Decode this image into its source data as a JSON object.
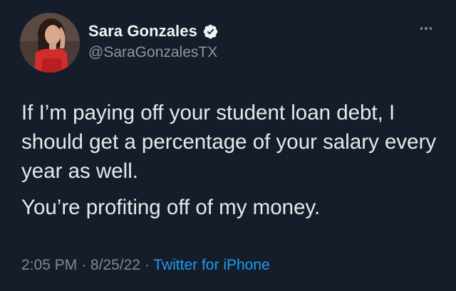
{
  "user": {
    "display_name": "Sara Gonzales",
    "handle": "@SaraGonzalesTX",
    "verified": true,
    "avatar": "profile-photo"
  },
  "tweet": {
    "paragraphs": [
      "If I’m paying off your student loan debt, I should get a percentage of your salary every year as well.",
      "You’re profiting off of my money."
    ]
  },
  "meta": {
    "time": "2:05 PM",
    "separator": "·",
    "date": "8/25/22",
    "source": "Twitter for iPhone"
  },
  "icons": {
    "verified": "verified-badge-icon",
    "more": "more-options-icon"
  },
  "colors": {
    "background": "#151d2a",
    "text": "#e7e9ea",
    "muted": "#7d8996",
    "link": "#1d9bf0"
  }
}
